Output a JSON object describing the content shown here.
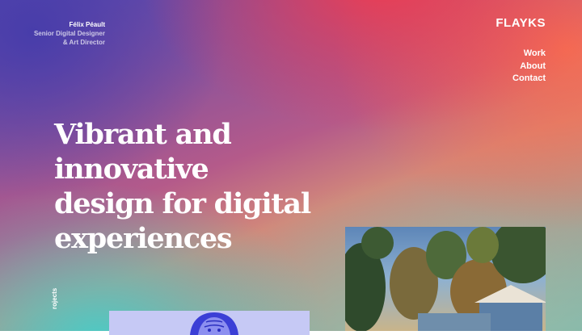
{
  "author": {
    "name": "Félix Péault",
    "role_line1": "Senior Digital Designer",
    "role_line2": "& Art Director"
  },
  "brand": {
    "logo": "FLAYKS"
  },
  "nav": {
    "items": [
      "Work",
      "About",
      "Contact"
    ]
  },
  "hero": {
    "lines": [
      "Vibrant and",
      "innovative",
      "design for digital",
      "experiences"
    ]
  },
  "side_label": "rojects",
  "colors": {
    "text": "#ffffff",
    "gradient_top_left": "#463caa",
    "gradient_top": "#f03c50",
    "gradient_right": "#f86e50",
    "gradient_bottom": "#46cdc8",
    "portrait_bg": "#c6c9f5"
  },
  "images": {
    "photo": "palm-trees-house-photo",
    "portrait": "blue-portrait-illustration"
  }
}
